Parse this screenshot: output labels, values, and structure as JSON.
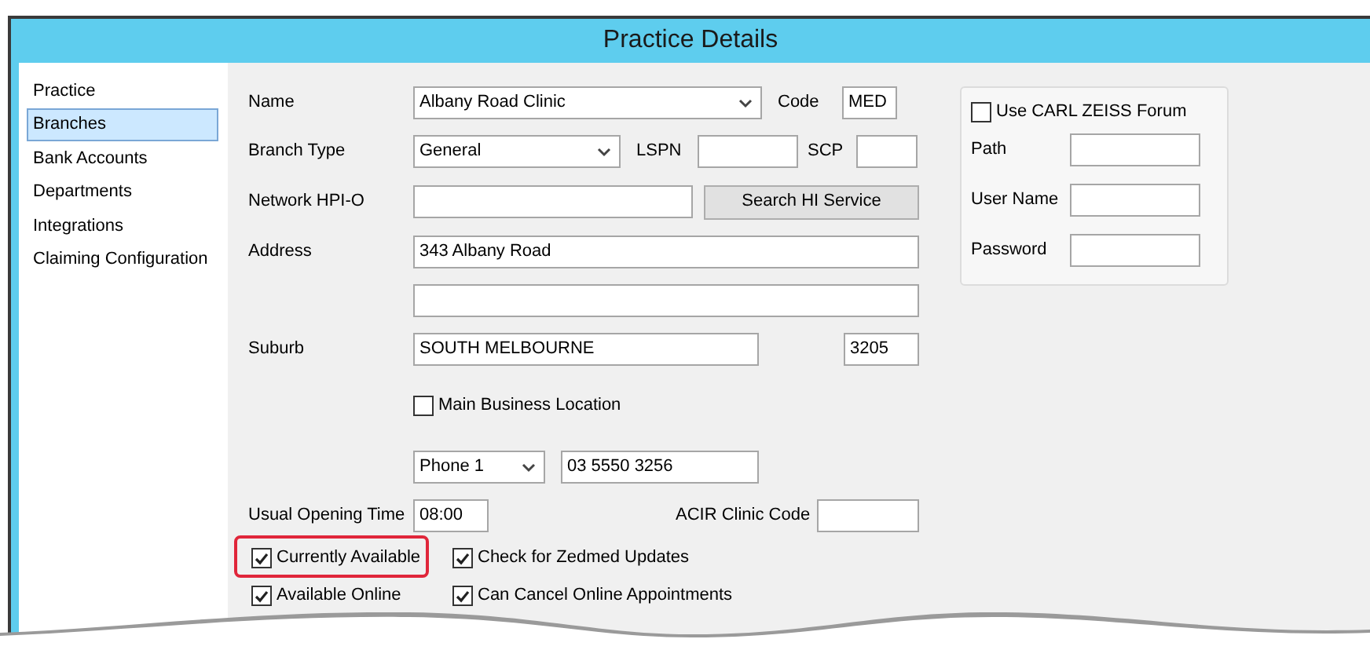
{
  "window": {
    "title": "Practice Details"
  },
  "sidebar": {
    "items": [
      {
        "label": "Practice",
        "selected": false
      },
      {
        "label": "Branches",
        "selected": true
      },
      {
        "label": "Bank Accounts",
        "selected": false
      },
      {
        "label": "Departments",
        "selected": false
      },
      {
        "label": "Integrations",
        "selected": false
      },
      {
        "label": "Claiming Configuration",
        "selected": false
      }
    ]
  },
  "form": {
    "name": {
      "label": "Name",
      "value": "Albany Road Clinic"
    },
    "code": {
      "label": "Code",
      "value": "MED"
    },
    "branch_type": {
      "label": "Branch Type",
      "value": "General"
    },
    "lspn": {
      "label": "LSPN"
    },
    "scp": {
      "label": "SCP"
    },
    "network_hpio": {
      "label": "Network HPI-O"
    },
    "search_button": "Search HI Service",
    "address": {
      "label": "Address",
      "line_1": "343 Albany Road"
    },
    "suburb": {
      "label": "Suburb",
      "value": "SOUTH MELBOURNE"
    },
    "postcode": {
      "value": "3205"
    },
    "main_business_location": {
      "label": "Main Business Location",
      "checked": false
    },
    "phone": {
      "type": "Phone 1",
      "value": "03 5550 3256"
    },
    "usual_opening_time": {
      "label": "Usual Opening Time",
      "value": "08:00"
    },
    "acir_clinic_code": {
      "label": "ACIR Clinic Code"
    },
    "options": [
      {
        "label": "Currently Available",
        "checked": true,
        "highlighted": true
      },
      {
        "label": "Check for Zedmed Updates",
        "checked": true,
        "highlighted": false
      },
      {
        "label": "Available Online",
        "checked": true,
        "highlighted": false
      },
      {
        "label": "Can Cancel Online Appointments",
        "checked": true,
        "highlighted": false
      }
    ]
  },
  "forum": {
    "enabled": {
      "label": "Use CARL ZEISS Forum",
      "checked": false
    },
    "fields": [
      {
        "label": "Path"
      },
      {
        "label": "User Name"
      },
      {
        "label": "Password"
      }
    ]
  }
}
